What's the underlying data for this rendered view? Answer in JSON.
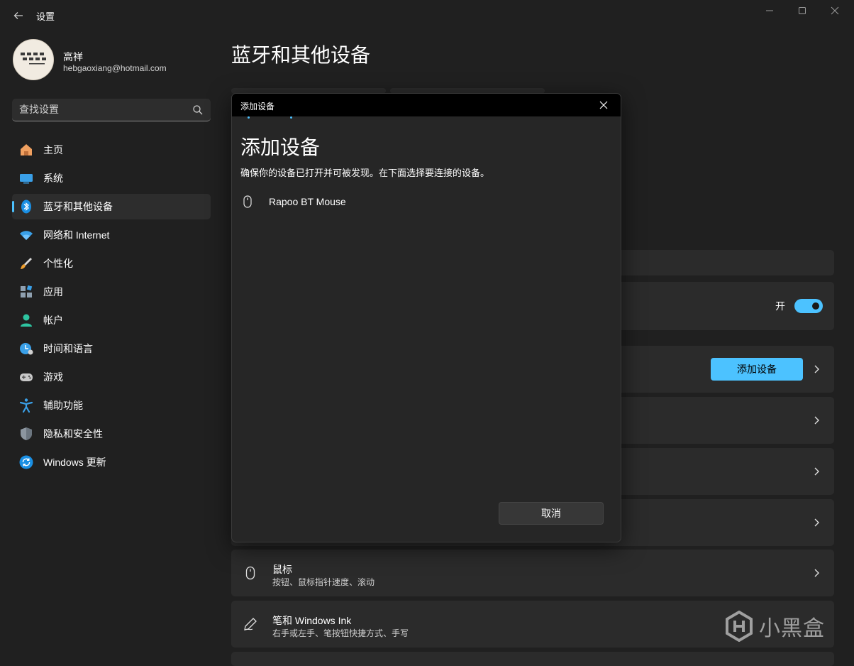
{
  "window": {
    "title": "设置"
  },
  "profile": {
    "name": "高祥",
    "email": "hebgaoxiang@hotmail.com",
    "avatar_text": "精 鍼 樹 術\n共 敦 賢 勤\n- 贈高祥同學"
  },
  "search": {
    "placeholder": "查找设置"
  },
  "nav": {
    "items": [
      {
        "label": "主页",
        "icon": "home-icon",
        "active": false
      },
      {
        "label": "系统",
        "icon": "system-icon",
        "active": false
      },
      {
        "label": "蓝牙和其他设备",
        "icon": "bluetooth-icon",
        "active": true
      },
      {
        "label": "网络和 Internet",
        "icon": "wifi-icon",
        "active": false
      },
      {
        "label": "个性化",
        "icon": "brush-icon",
        "active": false
      },
      {
        "label": "应用",
        "icon": "apps-icon",
        "active": false
      },
      {
        "label": "帐户",
        "icon": "account-icon",
        "active": false
      },
      {
        "label": "时间和语言",
        "icon": "time-language-icon",
        "active": false
      },
      {
        "label": "游戏",
        "icon": "gamepad-icon",
        "active": false
      },
      {
        "label": "辅助功能",
        "icon": "accessibility-icon",
        "active": false
      },
      {
        "label": "隐私和安全性",
        "icon": "shield-icon",
        "active": false
      },
      {
        "label": "Windows 更新",
        "icon": "update-icon",
        "active": false
      }
    ]
  },
  "main": {
    "title": "蓝牙和其他设备",
    "bluetooth_state": "开",
    "add_device_label": "添加设备",
    "mouse": {
      "title": "鼠标",
      "subtitle": "按钮、鼠标指针速度、滚动"
    },
    "pen": {
      "title": "笔和 Windows Ink",
      "subtitle": "右手或左手、笔按钮快捷方式、手写"
    }
  },
  "dialog": {
    "bar_title": "添加设备",
    "heading": "添加设备",
    "description": "确保你的设备已打开并可被发现。在下面选择要连接的设备。",
    "devices": [
      {
        "name": "Rapoo BT Mouse",
        "icon": "mouse-icon"
      }
    ],
    "cancel_label": "取消"
  },
  "watermark": {
    "text": "小黑盒"
  },
  "colors": {
    "accent": "#4cc2ff",
    "background": "#202020",
    "card": "#2b2b2b"
  }
}
